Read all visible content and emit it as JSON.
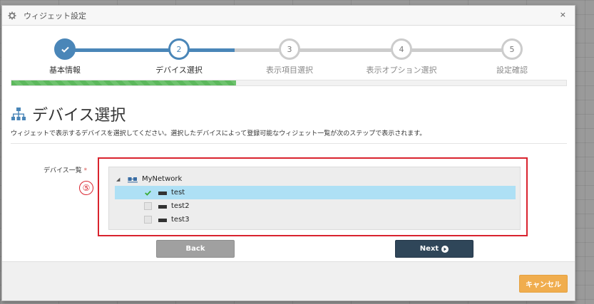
{
  "window": {
    "title": "ウィジェット設定",
    "close_glyph": "×"
  },
  "stepper": {
    "steps": [
      {
        "number": "✓",
        "label": "基本情報",
        "state": "done"
      },
      {
        "number": "2",
        "label": "デバイス選択",
        "state": "current"
      },
      {
        "number": "3",
        "label": "表示項目選択",
        "state": "todo"
      },
      {
        "number": "4",
        "label": "表示オプション選択",
        "state": "todo"
      },
      {
        "number": "5",
        "label": "設定確認",
        "state": "todo"
      }
    ],
    "colors": {
      "done": "#4a86b8",
      "todo": "#cccccc",
      "label_done": "#333333",
      "label_todo": "#8a8a8a"
    }
  },
  "progress": {
    "value_fraction": 0.405,
    "color": "#5cb85c"
  },
  "section": {
    "title": "デバイス選択",
    "icon": "network-tree-icon",
    "description": "ウィジェットで表示するデバイスを選択してください。選択したデバイスによって登録可能なウィジェット一覧が次のステップで表示されます。"
  },
  "device_field": {
    "label": "デバイス一覧",
    "required_mark": "*",
    "marker": "⑤",
    "root": {
      "label": "MyNetwork",
      "expanded": true
    },
    "devices": [
      {
        "label": "test",
        "checked": true,
        "selected": true
      },
      {
        "label": "test2",
        "checked": false,
        "selected": false
      },
      {
        "label": "test3",
        "checked": false,
        "selected": false
      }
    ]
  },
  "buttons": {
    "back": "Back",
    "next": "Next",
    "cancel": "キャンセル"
  }
}
